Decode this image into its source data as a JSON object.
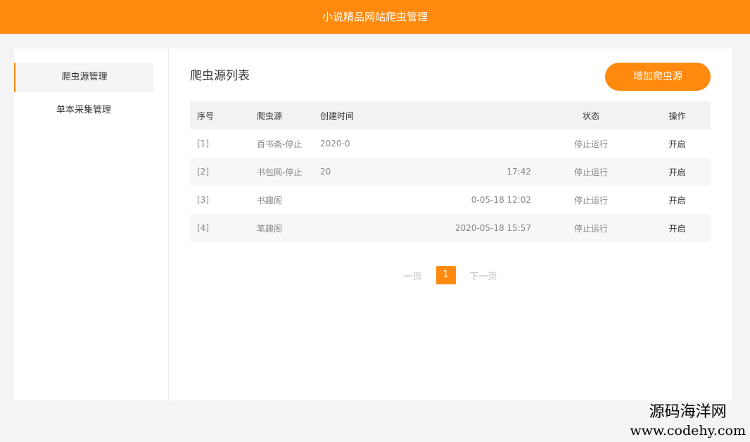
{
  "header": {
    "title": "小说精品网站爬虫管理"
  },
  "sidebar": {
    "items": [
      {
        "label": "爬虫源管理",
        "active": true
      },
      {
        "label": "单本采集管理",
        "active": false
      }
    ]
  },
  "main": {
    "title": "爬虫源列表",
    "add_button": "增加爬虫源",
    "columns": [
      "序号",
      "爬虫源",
      "创建时间",
      "",
      "状态",
      "操作"
    ],
    "rows": [
      {
        "index": "[1]",
        "source": "百书斋-停止",
        "created": "2020-0",
        "updated": "",
        "status": "停止运行",
        "action": "开启"
      },
      {
        "index": "[2]",
        "source": "书包网-停止",
        "created": "20",
        "updated": "17:42",
        "status": "停止运行",
        "action": "开启"
      },
      {
        "index": "[3]",
        "source": "书趣阁",
        "created": "",
        "updated": "0-05-18 12:02",
        "status": "停止运行",
        "action": "开启"
      },
      {
        "index": "[4]",
        "source": "笔趣阁",
        "created": "",
        "updated": "2020-05-18 15:57",
        "status": "停止运行",
        "action": "开启"
      }
    ]
  },
  "pagination": {
    "prev": "一页",
    "current": "1",
    "next": "下一页"
  },
  "watermark": {
    "name": "源码海洋网",
    "url": "www.codehy.com"
  },
  "colors": {
    "accent": "#ff8a0d"
  }
}
